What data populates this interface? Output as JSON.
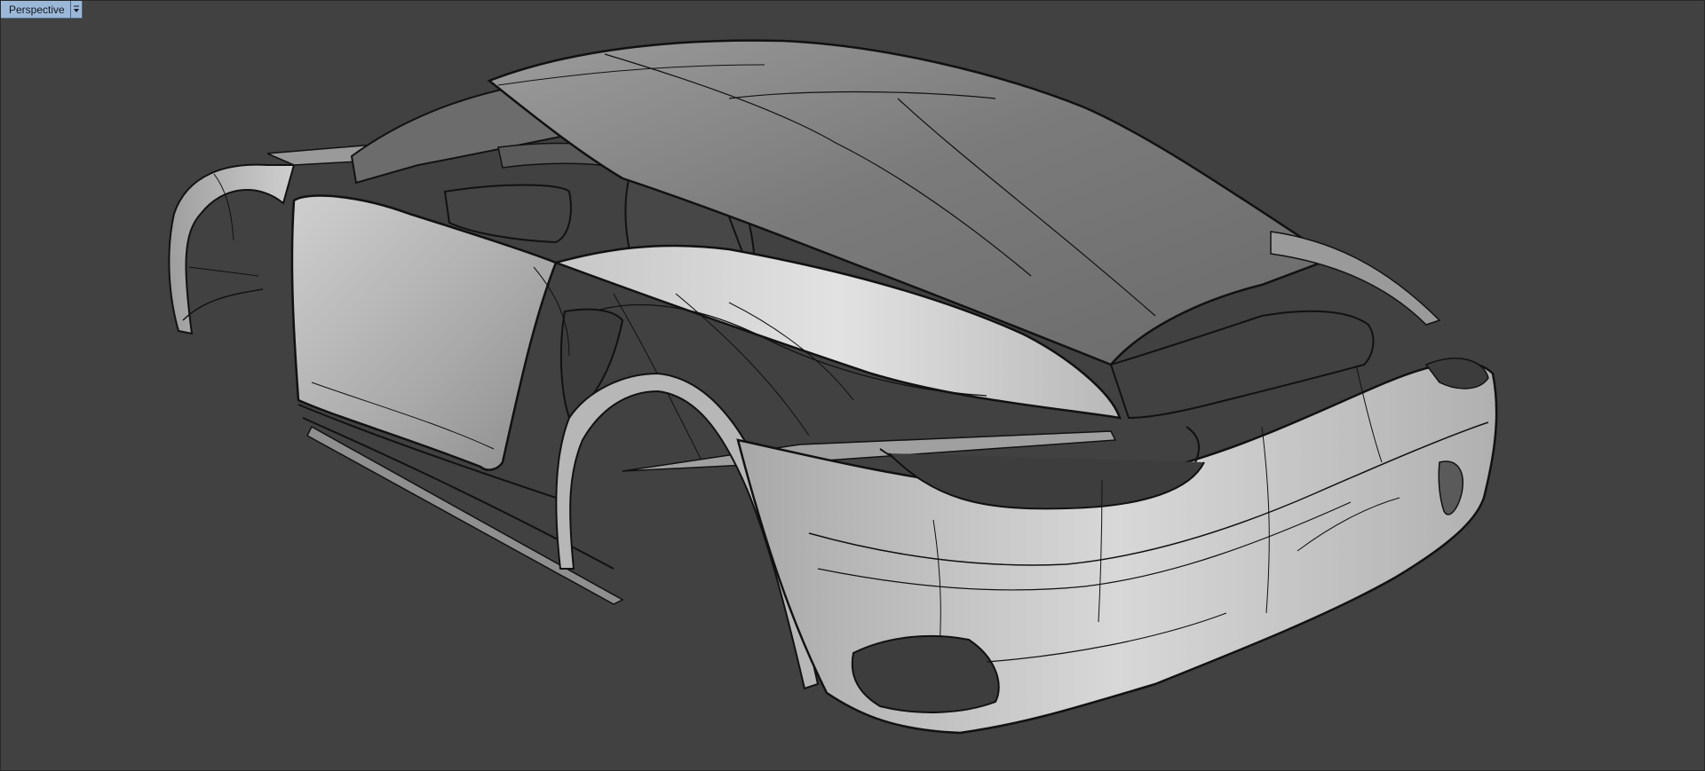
{
  "viewport": {
    "name": "Perspective",
    "menu_icon": "chevron-down-icon",
    "background_color": "#414141",
    "tab_color": "#9cb8d8"
  },
  "model": {
    "render_mode": "shaded-with-isocurves",
    "surface_color": "#b4b4b4",
    "edge_color": "#111111"
  }
}
